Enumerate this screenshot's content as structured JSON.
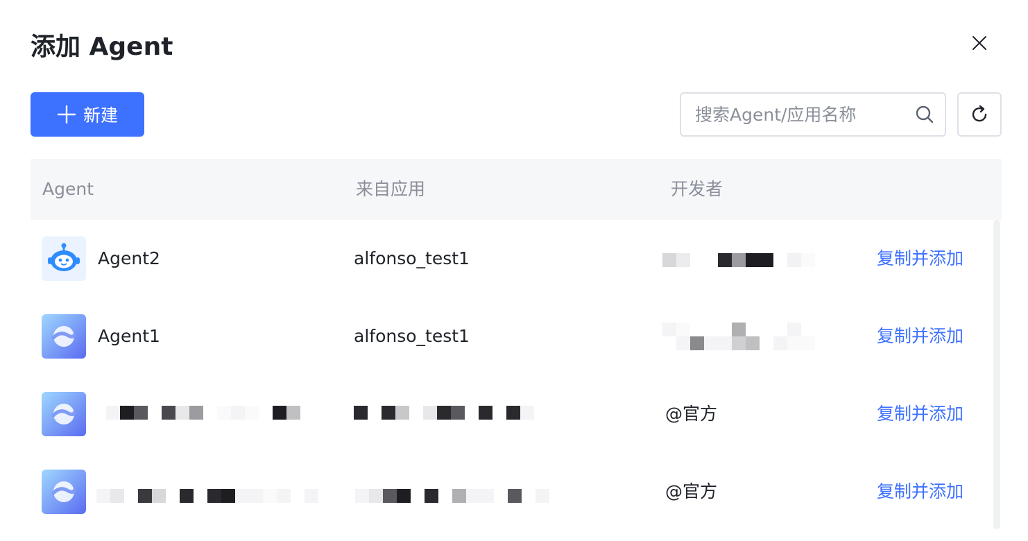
{
  "dialog": {
    "title": "添加 Agent"
  },
  "toolbar": {
    "new_label": "新建",
    "search_placeholder": "搜索Agent/应用名称"
  },
  "table": {
    "columns": [
      "Agent",
      "来自应用",
      "开发者"
    ],
    "rows": [
      {
        "agent": "Agent2",
        "app": "alfonso_test1",
        "developer": "",
        "action": "复制并添加",
        "avatar": "robot-icon"
      },
      {
        "agent": "Agent1",
        "app": "alfonso_test1",
        "developer": "",
        "action": "复制并添加",
        "avatar": "swirl-icon"
      },
      {
        "agent": "",
        "app": "",
        "developer": "@官方",
        "action": "复制并添加",
        "avatar": "swirl-icon"
      },
      {
        "agent": "",
        "app": "",
        "developer": "@官方",
        "action": "复制并添加",
        "avatar": "swirl-icon"
      }
    ]
  },
  "colors": {
    "accent": "#3d71ff",
    "header_bg": "#f6f7f9",
    "muted_text": "#8a8f99"
  }
}
